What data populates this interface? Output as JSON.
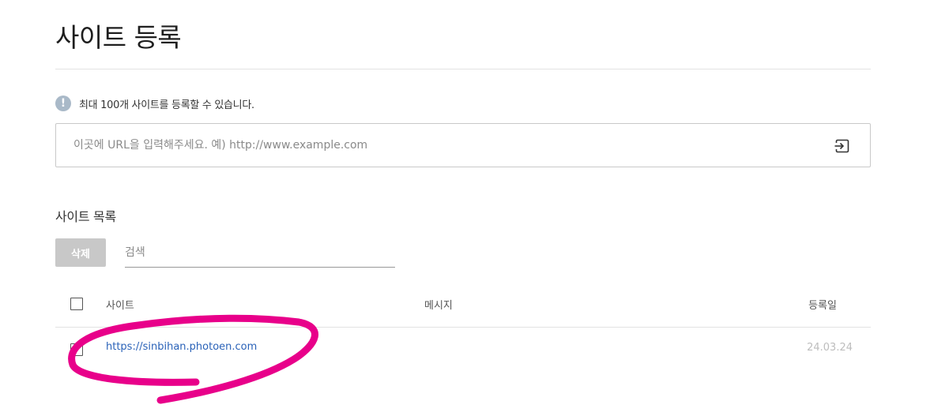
{
  "page": {
    "title": "사이트 등록"
  },
  "notice": {
    "icon": "info-icon",
    "icon_glyph": "!",
    "text": "최대 100개 사이트를 등록할 수 있습니다."
  },
  "url_form": {
    "placeholder": "이곳에 URL을 입력해주세요. 예) http://www.example.com",
    "value": "",
    "submit_icon": "enter-icon"
  },
  "site_list": {
    "title": "사이트 목록",
    "delete_label": "삭제",
    "search_placeholder": "검색",
    "columns": {
      "site": "사이트",
      "message": "메시지",
      "registered": "등록일"
    },
    "rows": [
      {
        "site": "https://sinbihan.photoen.com",
        "message": "",
        "registered": "24.03.24",
        "checked": false
      }
    ]
  },
  "colors": {
    "link": "#2a62b8",
    "annotation": "#e8008a",
    "delete_button": "#c8c8c8",
    "info_icon": "#a9b9c8"
  }
}
